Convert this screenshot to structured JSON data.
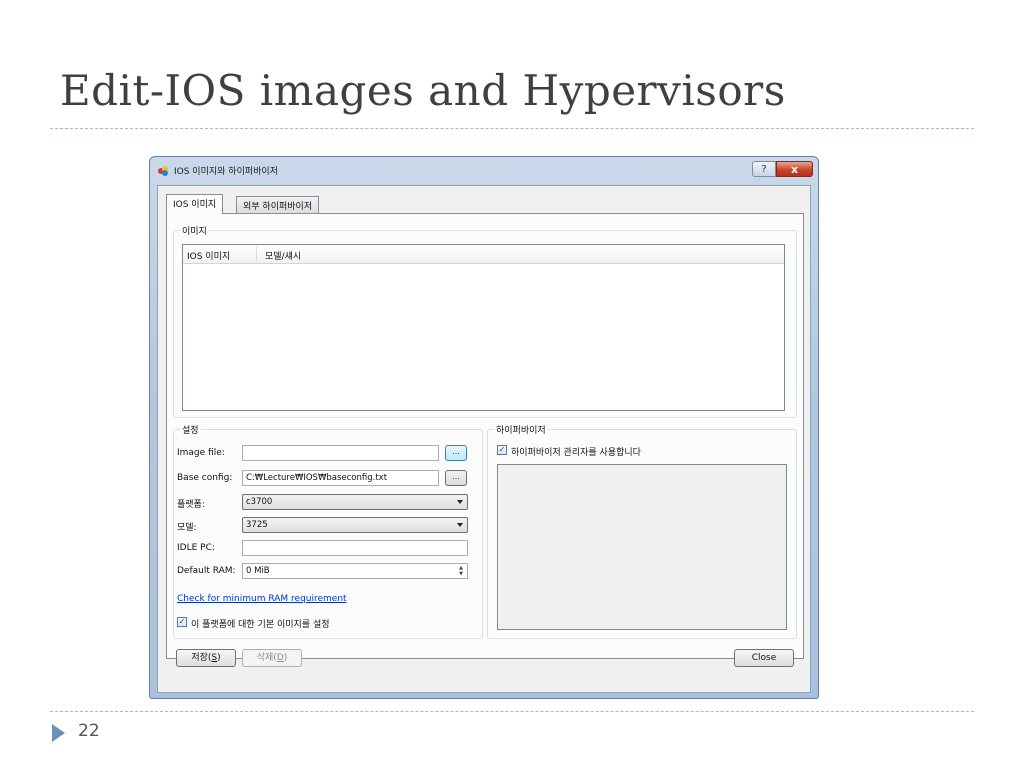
{
  "slide": {
    "title": "Edit-IOS images and Hypervisors",
    "page_number": "22"
  },
  "window": {
    "title": "IOS 이미지와 하이퍼바이저",
    "help_label": "?",
    "close_label": "x"
  },
  "tabs": [
    {
      "label": "IOS 이미지",
      "active": true
    },
    {
      "label": "외부 하이퍼바이저",
      "active": false
    }
  ],
  "images_group": {
    "title": "이미지",
    "columns": [
      "IOS 이미지",
      "모델/섀시"
    ]
  },
  "settings": {
    "title": "설정",
    "image_file_label": "Image file:",
    "image_file_value": "",
    "browse_label": "...",
    "base_config_label": "Base config:",
    "base_config_value": "C:₩Lecture₩IOS₩baseconfig.txt",
    "platform_label": "플랫폼:",
    "platform_value": "c3700",
    "model_label": "모델:",
    "model_value": "3725",
    "idle_pc_label": "IDLE PC:",
    "idle_pc_value": "",
    "default_ram_label": "Default RAM:",
    "default_ram_value": "0 MiB",
    "min_ram_link": "Check for minimum RAM requirement",
    "default_image_checkbox": "이 플랫폼에 대한 기본 이미지를 설정",
    "default_image_checked": true
  },
  "hypervisors": {
    "title": "하이퍼바이저",
    "manager_checkbox": "하이퍼바이저 관리자를 사용합니다",
    "manager_checked": true
  },
  "buttons": {
    "save_prefix": "저장(",
    "save_key": "S",
    "save_suffix": ")",
    "delete_prefix": "삭제(",
    "delete_key": "D",
    "delete_suffix": ")",
    "close": "Close"
  },
  "icons": {
    "app": "app-logo-icon",
    "check_mark": "✓"
  }
}
